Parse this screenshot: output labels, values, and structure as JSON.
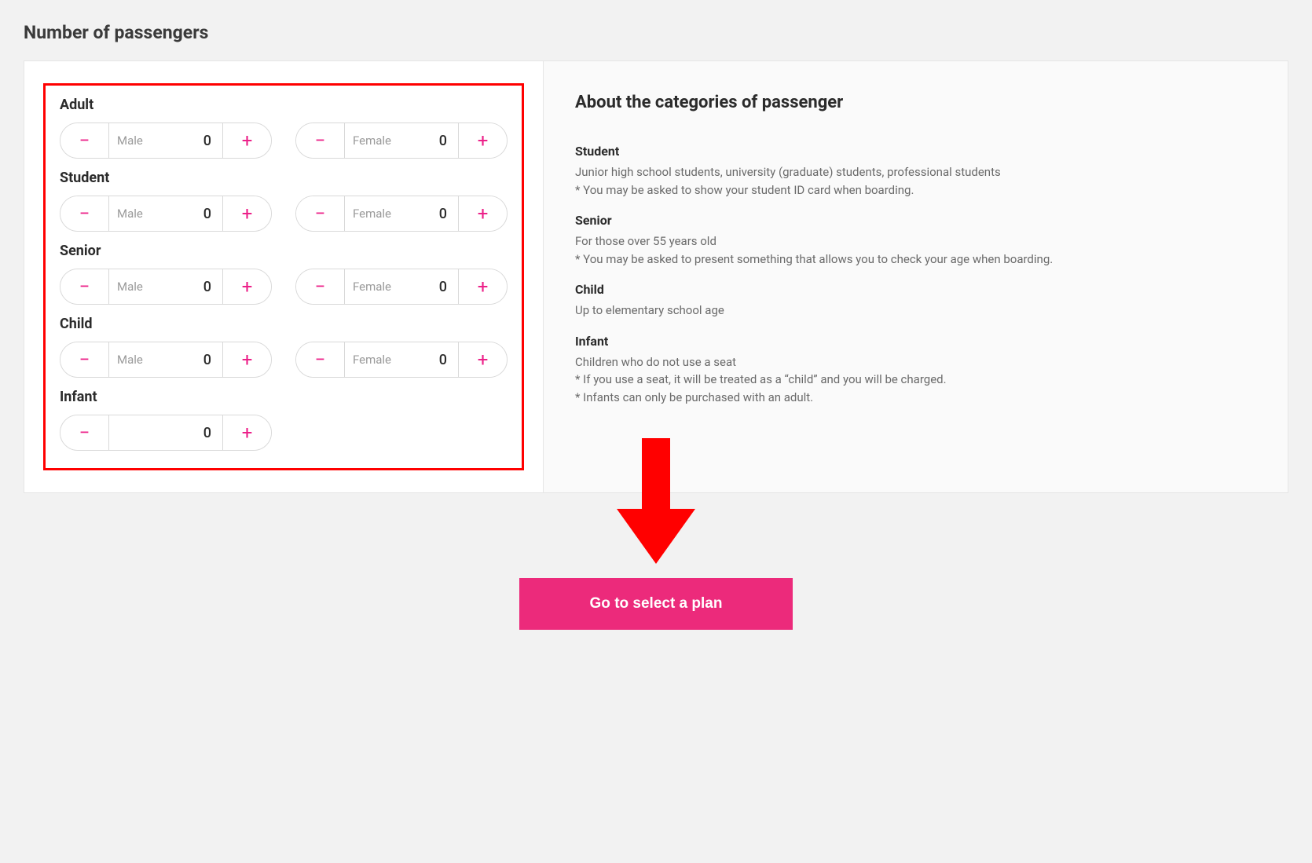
{
  "page": {
    "title": "Number of passengers"
  },
  "labels": {
    "male": "Male",
    "female": "Female"
  },
  "categories": {
    "adult": {
      "label": "Adult",
      "male": 0,
      "female": 0
    },
    "student": {
      "label": "Student",
      "male": 0,
      "female": 0
    },
    "senior": {
      "label": "Senior",
      "male": 0,
      "female": 0
    },
    "child": {
      "label": "Child",
      "male": 0,
      "female": 0
    },
    "infant": {
      "label": "Infant",
      "count": 0
    }
  },
  "about": {
    "title": "About the categories of passenger",
    "student": {
      "h": "Student",
      "p": "Junior high school students, university (graduate) students, professional students\n* You may be asked to show your student ID card when boarding."
    },
    "senior": {
      "h": "Senior",
      "p": "For those over 55 years old\n* You may be asked to present something that allows you to check your age when boarding."
    },
    "child": {
      "h": "Child",
      "p": "Up to elementary school age"
    },
    "infant": {
      "h": "Infant",
      "p": "Children who do not use a seat\n* If you use a seat, it will be treated as a “child” and you will be charged.\n* Infants can only be purchased with an adult."
    }
  },
  "cta": {
    "label": "Go to select a plan"
  },
  "colors": {
    "accent": "#ec2a7b",
    "highlight": "#ff0000"
  }
}
